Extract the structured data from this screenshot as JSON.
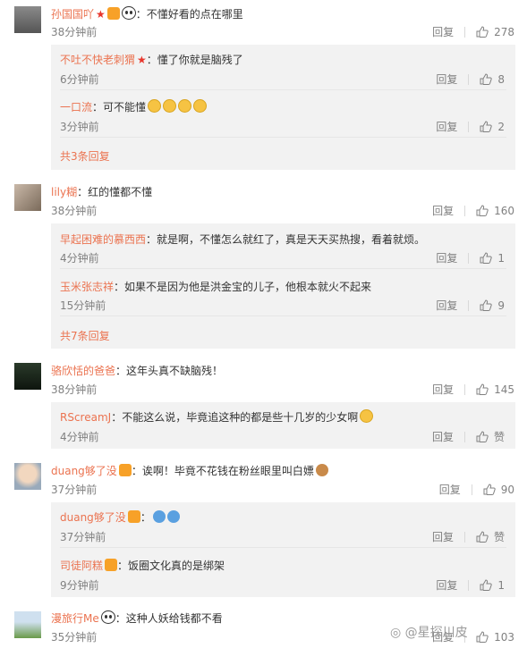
{
  "comments": [
    {
      "author": "孙国国吖",
      "text": "：不懂好看的点在哪里",
      "time": "38分钟前",
      "reply_label": "回复",
      "likes": "278",
      "replies": [
        {
          "author": "不吐不快老刺猬",
          "text": "：懂了你就是脑残了",
          "time": "6分钟前",
          "reply_label": "回复",
          "likes": "8"
        },
        {
          "author": "一口流",
          "text": "：可不能懂",
          "time": "3分钟前",
          "reply_label": "回复",
          "likes": "2"
        }
      ],
      "more": "共3条回复"
    },
    {
      "author": "lily糊",
      "text": "：红的懂都不懂",
      "time": "38分钟前",
      "reply_label": "回复",
      "likes": "160",
      "replies": [
        {
          "author": "早起困难的慕西西",
          "text": "：就是啊，不懂怎么就红了，真是天天买热搜，看着就烦。",
          "time": "4分钟前",
          "reply_label": "回复",
          "likes": "1"
        },
        {
          "author": "玉米张志祥",
          "text": "：如果不是因为他是洪金宝的儿子，他根本就火不起来",
          "time": "15分钟前",
          "reply_label": "回复",
          "likes": "9"
        }
      ],
      "more": "共7条回复"
    },
    {
      "author": "骆欣恬的爸爸",
      "text": "：这年头真不缺脑残！",
      "time": "38分钟前",
      "reply_label": "回复",
      "likes": "145",
      "replies": [
        {
          "author": "RScreamJ",
          "text": "：不能这么说，毕竟追这种的都是些十几岁的少女啊",
          "time": "4分钟前",
          "reply_label": "回复",
          "likes": "赞"
        }
      ]
    },
    {
      "author": "duang够了没",
      "text": "：诶啊！毕竟不花钱在粉丝眼里叫白嫖",
      "time": "37分钟前",
      "reply_label": "回复",
      "likes": "90",
      "replies": [
        {
          "author": "duang够了没",
          "text": "：",
          "time": "37分钟前",
          "reply_label": "回复",
          "likes": "赞"
        },
        {
          "author": "司徒阿糕",
          "text": "：饭圈文化真的是绑架",
          "time": "9分钟前",
          "reply_label": "回复",
          "likes": "1"
        }
      ]
    },
    {
      "author": "漫旅行Me",
      "text": "：这种人妖给钱都不看",
      "time": "35分钟前",
      "reply_label": "回复",
      "likes": "103"
    }
  ],
  "watermark": "@星探川皮",
  "colors": {
    "name": "#eb7350",
    "text": "#333333",
    "meta": "#808080",
    "reply_bg": "#f2f2f2"
  }
}
